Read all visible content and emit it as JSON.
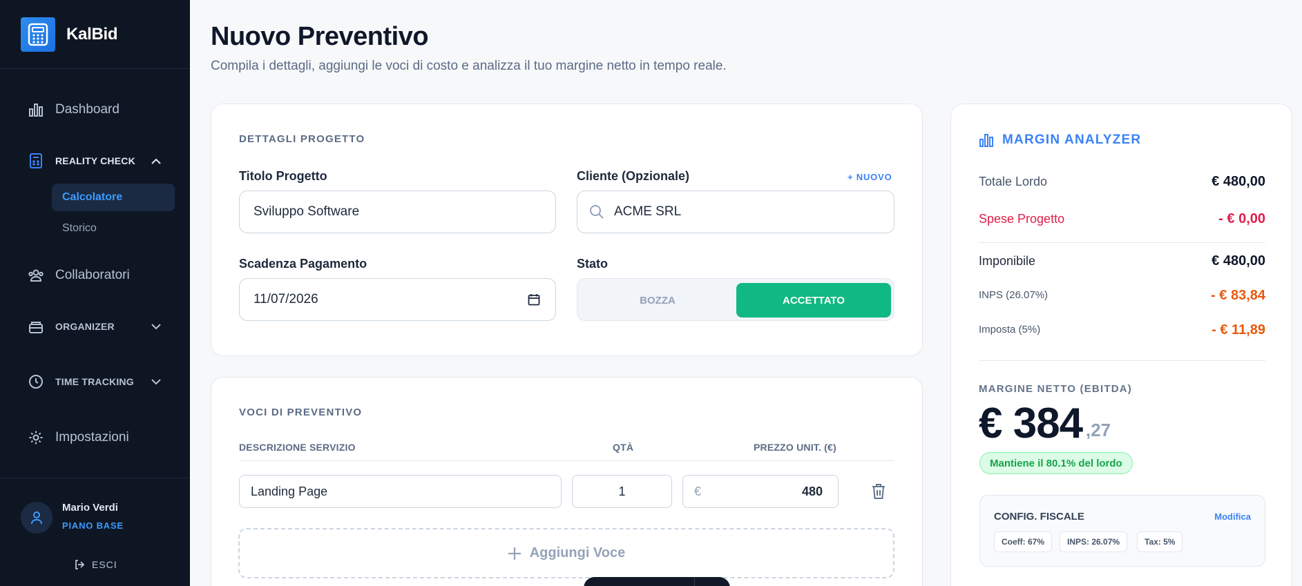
{
  "brand": {
    "name": "KalBid"
  },
  "sidebar": {
    "dashboard": "Dashboard",
    "reality_check": "REALITY CHECK",
    "calcolatore": "Calcolatore",
    "storico": "Storico",
    "collaboratori": "Collaboratori",
    "organizer": "ORGANIZER",
    "time_tracking": "TIME TRACKING",
    "impostazioni": "Impostazioni"
  },
  "user": {
    "name": "Mario Verdi",
    "plan": "PIANO BASE",
    "logout": "ESCI"
  },
  "header": {
    "title": "Nuovo Preventivo",
    "subtitle": "Compila i dettagli, aggiungi le voci di costo e analizza il tuo margine netto in tempo reale."
  },
  "project": {
    "section_label": "DETTAGLI PROGETTO",
    "title_label": "Titolo Progetto",
    "title_value": "Sviluppo Software",
    "client_label": "Cliente (Opzionale)",
    "client_add": "+ NUOVO",
    "client_value": "ACME SRL",
    "due_label": "Scadenza Pagamento",
    "due_value": "11/07/2026",
    "status_label": "Stato",
    "status_draft": "BOZZA",
    "status_accepted": "ACCETTATO"
  },
  "items": {
    "section_label": "VOCI DI PREVENTIVO",
    "col_desc": "DESCRIZIONE SERVIZIO",
    "col_qty": "QTÀ",
    "col_price": "PREZZO UNIT. (€)",
    "rows": [
      {
        "desc": "Landing Page",
        "qty": "1",
        "currency": "€",
        "price": "480"
      }
    ],
    "add_label": "Aggiungi Voce"
  },
  "analyzer": {
    "title": "MARGIN ANALYZER",
    "gross_label": "Totale Lordo",
    "gross_value": "€ 480,00",
    "expenses_label": "Spese Progetto",
    "expenses_value": "- € 0,00",
    "taxable_label": "Imponibile",
    "taxable_value": "€ 480,00",
    "inps_label": "INPS (26.07%)",
    "inps_value": "- € 83,84",
    "tax_label": "Imposta (5%)",
    "tax_value": "- € 11,89",
    "net_label": "MARGINE NETTO (EBITDA)",
    "net_int": "€ 384",
    "net_dec": ",27",
    "retain": "Mantiene il 80.1% del lordo",
    "fiscal_title": "CONFIG. FISCALE",
    "fiscal_edit": "Modifica",
    "chip_coeff": "Coeff: 67%",
    "chip_inps": "INPS: 26.07%",
    "chip_tax": "Tax: 5%"
  },
  "colors": {
    "accent": "#3b82f6",
    "success": "#10b981",
    "danger": "#e11d48",
    "warning": "#ea580c",
    "sidebar": "#0f1623"
  }
}
